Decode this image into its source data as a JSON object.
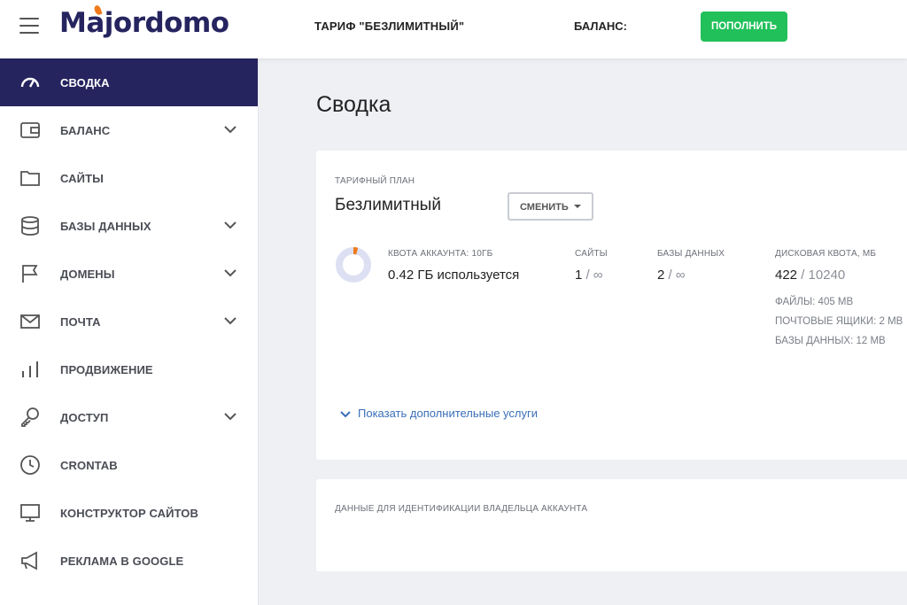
{
  "header": {
    "logo": "Majordomo",
    "tariff": "ТАРИФ \"БЕЗЛИМИТНЫЙ\"",
    "balance_label": "БАЛАНС:",
    "topup_button": "ПОПОЛНИТЬ"
  },
  "sidebar": {
    "items": [
      {
        "label": "СВОДКА",
        "icon": "gauge-icon",
        "active": true
      },
      {
        "label": "БАЛАНС",
        "icon": "wallet-icon",
        "expandable": true
      },
      {
        "label": "САЙТЫ",
        "icon": "folder-icon"
      },
      {
        "label": "БАЗЫ ДАННЫХ",
        "icon": "database-icon",
        "expandable": true
      },
      {
        "label": "ДОМЕНЫ",
        "icon": "flag-icon",
        "expandable": true
      },
      {
        "label": "ПОЧТА",
        "icon": "mail-icon",
        "expandable": true
      },
      {
        "label": "ПРОДВИЖЕНИЕ",
        "icon": "bar-chart-icon"
      },
      {
        "label": "ДОСТУП",
        "icon": "key-icon",
        "expandable": true
      },
      {
        "label": "CRONTAB",
        "icon": "clock-icon"
      },
      {
        "label": "КОНСТРУКТОР САЙТОВ",
        "icon": "monitor-icon"
      },
      {
        "label": "РЕКЛАМА В GOOGLE",
        "icon": "megaphone-icon"
      }
    ]
  },
  "main": {
    "title": "Сводка",
    "plan": {
      "caption": "ТАРИФНЫЙ ПЛАН",
      "name": "Безлимитный",
      "change_button": "СМЕНИТЬ"
    },
    "quota": {
      "caption": "КВОТА АККАУНТА: 10ГБ",
      "used": "0.42 ГБ используется",
      "used_fraction": 0.042
    },
    "sites": {
      "caption": "САЙТЫ",
      "value": "1",
      "limit": "/ ∞"
    },
    "databases": {
      "caption": "БАЗЫ ДАННЫХ",
      "value": "2",
      "limit": "/ ∞"
    },
    "disk": {
      "caption": "ДИСКОВАЯ КВОТА, МБ",
      "value": "422",
      "limit": "/ 10240",
      "files": "ФАЙЛЫ: 405 МВ",
      "mailboxes": "ПОЧТОВЫЕ ЯЩИКИ: 2 МВ",
      "databases": "БАЗЫ ДАННЫХ: 12 МВ"
    },
    "more_services": "Показать дополнительные услуги",
    "owner_caption": "ДАННЫЕ ДЛЯ ИДЕНТИФИКАЦИИ ВЛАДЕЛЬЦА АККАУНТА"
  },
  "colors": {
    "brand": "#26245f",
    "accent_green": "#21c05a",
    "quota_orange": "#f07a1a",
    "link_blue": "#3a6fb8"
  }
}
